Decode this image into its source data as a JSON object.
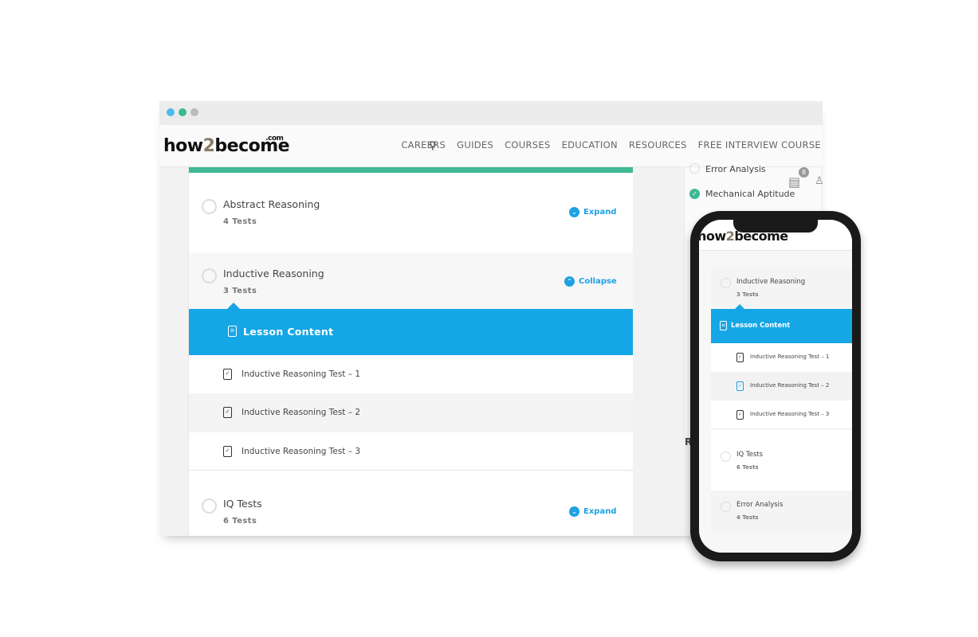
{
  "browser": {
    "logo": "how2become",
    "logo_suffix": ".com",
    "nav": [
      "CAREERS",
      "GUIDES",
      "COURSES",
      "EDUCATION",
      "RESOURCES",
      "FREE INTERVIEW COURSE"
    ],
    "cart_count": "8",
    "sidebar": [
      {
        "label": "Error Analysis",
        "done": false
      },
      {
        "label": "Mechanical Aptitude",
        "done": true
      }
    ],
    "sections": [
      {
        "title": "Abstract Reasoning",
        "sub": "4 Tests",
        "toggle": "Expand"
      },
      {
        "title": "Inductive Reasoning",
        "sub": "3 Tests",
        "toggle": "Collapse"
      },
      {
        "title": "IQ Tests",
        "sub": "6 Tests",
        "toggle": "Expand"
      }
    ],
    "lesson_label": "Lesson Content",
    "tests": [
      "Inductive Reasoning Test – 1",
      "Inductive Reasoning Test – 2",
      "Inductive Reasoning Test – 3"
    ],
    "side_letter": "R"
  },
  "phone": {
    "logo": "how2become",
    "sections": [
      {
        "title": "Inductive Reasoning",
        "sub": "3 Tests"
      },
      {
        "title": "IQ Tests",
        "sub": "6 Tests"
      },
      {
        "title": "Error Analysis",
        "sub": "4 Tests"
      }
    ],
    "lesson_label": "Lesson Content",
    "tests": [
      "Inductive Reasoning Test – 1",
      "Inductive Reasoning Test – 2",
      "Inductive Reasoning Test – 3"
    ]
  },
  "colors": {
    "accent": "#15a6e6",
    "green": "#3fb894"
  }
}
